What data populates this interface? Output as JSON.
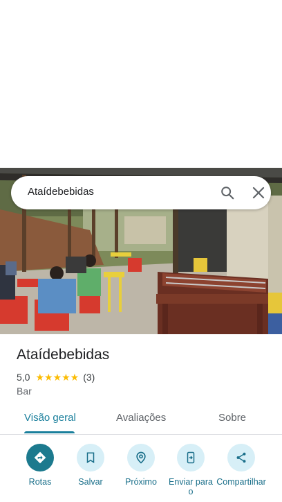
{
  "search": {
    "query": "Ataídebebidas"
  },
  "place": {
    "name": "Ataídebebidas",
    "rating": "5,0",
    "stars": "★★★★★",
    "review_count": "(3)",
    "category": "Bar"
  },
  "tabs": [
    {
      "label": "Visão geral",
      "active": true
    },
    {
      "label": "Avaliações",
      "active": false
    },
    {
      "label": "Sobre",
      "active": false
    }
  ],
  "actions": [
    {
      "label": "Rotas",
      "icon": "directions-icon"
    },
    {
      "label": "Salvar",
      "icon": "bookmark-icon"
    },
    {
      "label": "Próximo",
      "icon": "nearby-icon"
    },
    {
      "label": "Enviar para o",
      "icon": "send-to-phone-icon"
    },
    {
      "label": "Compartilhar",
      "icon": "share-icon"
    }
  ],
  "colors": {
    "accent": "#1a7f9c",
    "primary_button": "#1c7a8e",
    "button_bg": "#d7eff7",
    "star": "#fbbc04"
  }
}
